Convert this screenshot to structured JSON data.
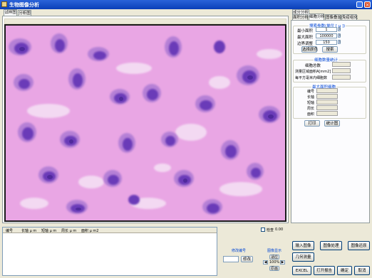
{
  "window": {
    "title": "生物图像分析"
  },
  "left_tabs": [
    "试样图",
    "分析图"
  ],
  "right_tabs_row1": [
    "成分分析"
  ],
  "right_tabs_row2": [
    "面积分析",
    "细胞分析",
    "图像叠加",
    "免疫组化"
  ],
  "search_params": {
    "title": "搜索参数(单位 [ μ ])",
    "min_area_label": "最小面积",
    "min_area_value": "1",
    "max_area_label": "最大面积",
    "max_area_value": "100000",
    "edge_adjust_label": "边界调整",
    "edge_adjust_value": "150",
    "select_color_button": "选择颜色",
    "search_button": "搜索"
  },
  "cell_stats": {
    "title": "细胞数量统计",
    "total_label": "细胞总数",
    "area_label": "测量区域面积A[mm2]",
    "density_label": "每平方毫米内细胞数"
  },
  "max_cell": {
    "title": "最大面积细胞",
    "fields": [
      "编号",
      "长轴",
      "短轴",
      "周长",
      "面积"
    ]
  },
  "print_button": "打印",
  "chart_button": "统计图",
  "table_headers": [
    "编号",
    "长轴 μ m",
    "短轴 μ m",
    "周长 μ m",
    "面积 μ m2"
  ],
  "checkbox": {
    "label": "检查",
    "value": "0.00"
  },
  "modify_number": {
    "label": "修改编号",
    "button": "修改"
  },
  "image_display": {
    "label": "图像显示",
    "fit": "适应",
    "zoom": "100%",
    "original": "原画"
  },
  "bottom_buttons": {
    "import": "输入图像",
    "process": "图像处理",
    "restore": "图像还原",
    "geometry": "几何测量",
    "excel": "EXCEL",
    "report": "打开报告",
    "ok": "确定",
    "cancel": "取消"
  }
}
